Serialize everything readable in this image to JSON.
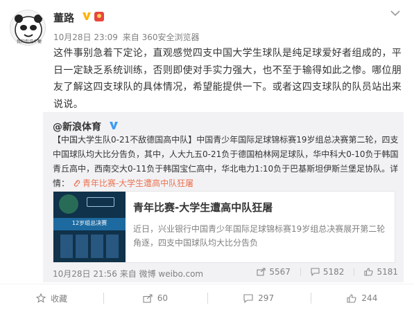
{
  "post": {
    "avatar_caption": "我和你说个梗",
    "username": "董路",
    "time": "10月28日 23:09",
    "source": "来自 360安全浏览器",
    "text": "这件事别急着下定论，直观感觉四支中国大学生球队是纯足球爱好者组成的，平日一定缺乏系统训练，否则即使对手实力强大，也不至于输得如此之惨。哪位朋友了解这四支球队的具体情况，希望能提供一下。或者这四支球队的队员站出来说说。"
  },
  "repost": {
    "username": "@新浪体育",
    "text": "【中国大学生队0-21不敌德国高中队】中国青少年国际足球锦标赛19岁组总决赛第二轮，四支中国球队均大比分告负，其中，人大九五0-21负于德国柏林网足球队，华中科大0-10负于韩国青丘高中，西南交大0-11负于韩国宝仁高中，华北电力1:10负于巴基斯坦伊斯兰堡足协队。详情：",
    "link_text": "青年比赛-大学生遭高中队狂屠",
    "card": {
      "thumb_band_text": "12岁组总决赛",
      "title": "青年比赛-大学生遭高中队狂屠",
      "desc": "近日，兴业银行中国青少年国际足球锦标赛19岁组总决赛展开第二轮角逐，四支中国球队均大比分告负"
    },
    "time": "10月28日 21:56",
    "source": "来自 微博 weibo.com",
    "reposts": "5567",
    "comments": "5182",
    "likes": "5181"
  },
  "footer": {
    "favorite": "收藏",
    "repost": "60",
    "comment": "297",
    "like": "244"
  },
  "colors": {
    "link": "#eb7350",
    "verify": "#ffb400",
    "meta": "#808080"
  }
}
